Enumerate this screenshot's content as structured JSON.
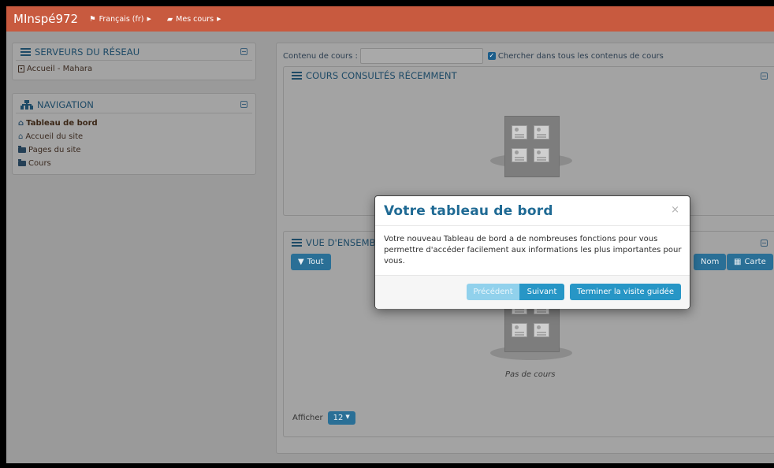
{
  "navbar": {
    "brand": "MInspé972",
    "language": "Français (fr)",
    "my_courses": "Mes cours"
  },
  "network_block": {
    "title": "SERVEURS DU RÉSEAU",
    "items": [
      {
        "label": "Accueil - Mahara"
      }
    ]
  },
  "navigation_block": {
    "title": "NAVIGATION",
    "items": [
      {
        "label": "Tableau de bord"
      },
      {
        "label": "Accueil du site"
      },
      {
        "label": "Pages du site"
      },
      {
        "label": "Cours"
      }
    ]
  },
  "main": {
    "search_label": "Contenu de cours :",
    "search_value": "",
    "search_all_label": "Chercher dans tous les contenus de cours",
    "search_all_checked": true,
    "recent_courses_title": "COURS CONSULTÉS RÉCEMMENT",
    "overview_title": "VUE D'ENSEMBL",
    "filter_all": "Tout",
    "sort_name": "Nom",
    "view_card": "Carte",
    "no_courses": "Pas de cours",
    "show_label": "Afficher",
    "show_count": "12"
  },
  "tour_modal": {
    "title": "Votre tableau de bord",
    "close": "×",
    "body": "Votre nouveau Tableau de bord a de nombreuses fonctions pour vous permettre d'accéder facilement aux informations les plus importantes pour vous.",
    "prev_label": "Précédent",
    "next_label": "Suivant",
    "end_label": "Terminer la visite guidée"
  },
  "colors": {
    "navbar": "#c85a3f",
    "overlay": "#9a9a9a",
    "modal_title": "#1f6a94",
    "primary_button": "#2796c6"
  }
}
